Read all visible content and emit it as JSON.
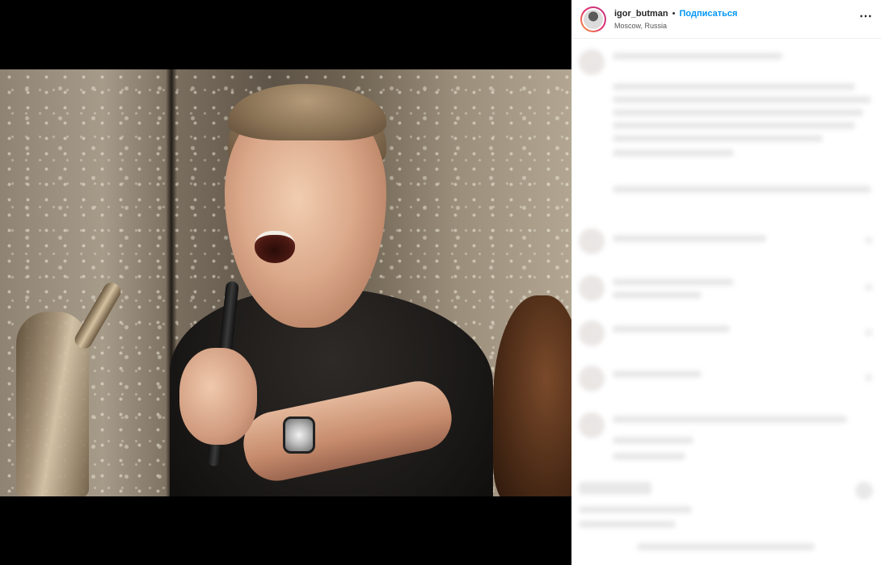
{
  "post": {
    "username": "igor_butman",
    "separator": "•",
    "follow_label": "Подписаться",
    "location": "Moscow, Russia",
    "more_icon": "more-options-icon"
  },
  "colors": {
    "follow_blue": "#0095f6",
    "media_background": "#000000",
    "pane_background": "#ffffff"
  }
}
